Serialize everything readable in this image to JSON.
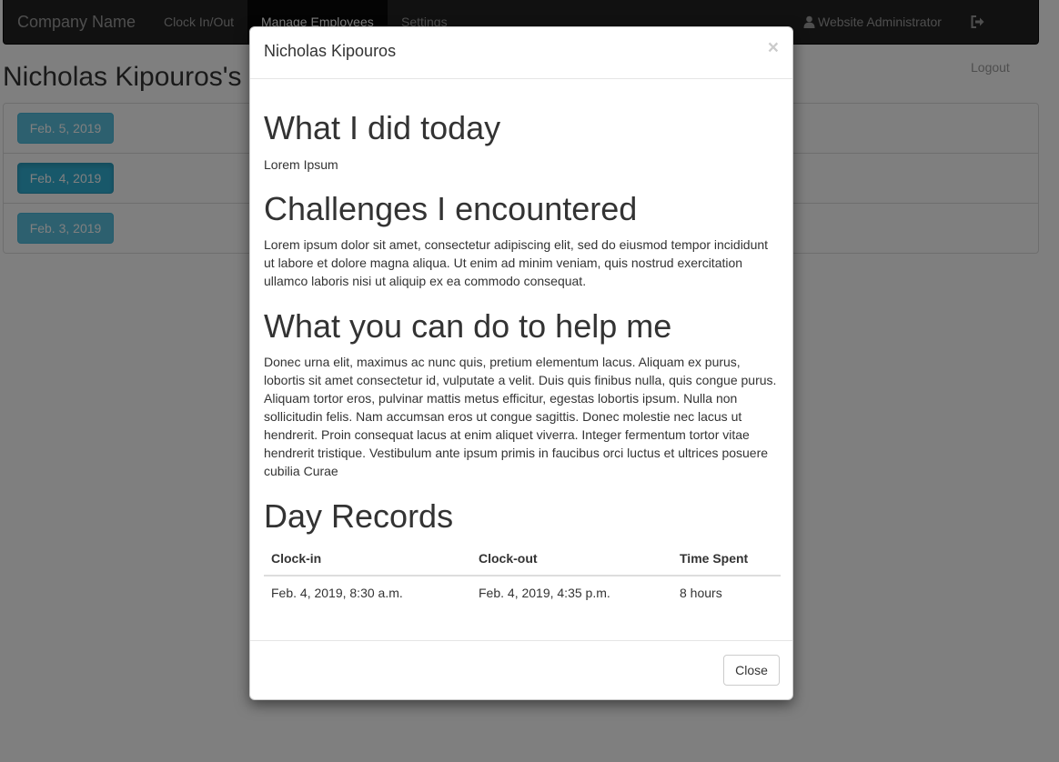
{
  "navbar": {
    "brand": "Company Name",
    "links": [
      {
        "label": "Clock In/Out"
      },
      {
        "label": "Manage Employees",
        "active": true
      },
      {
        "label": "Settings"
      }
    ],
    "user": {
      "label": "Website Administrator",
      "icon": "user-icon"
    },
    "logout": {
      "label": "Logout",
      "icon": "logout-icon"
    }
  },
  "page": {
    "title": "Nicholas Kipouros's",
    "dates": [
      {
        "label": "Feb. 5, 2019"
      },
      {
        "label": "Feb. 4, 2019",
        "active": true
      },
      {
        "label": "Feb. 3, 2019"
      }
    ]
  },
  "modal": {
    "title": "Nicholas Kipouros",
    "close_symbol": "×",
    "sections": {
      "did": {
        "heading": "What I did today",
        "text": "Lorem Ipsum"
      },
      "challenges": {
        "heading": "Challenges I encountered",
        "text": "Lorem ipsum dolor sit amet, consectetur adipiscing elit, sed do eiusmod tempor incididunt ut labore et dolore magna aliqua. Ut enim ad minim veniam, quis nostrud exercitation ullamco laboris nisi ut aliquip ex ea commodo consequat."
      },
      "help": {
        "heading": "What you can do to help me",
        "text": "Donec urna elit, maximus ac nunc quis, pretium elementum lacus. Aliquam ex purus, lobortis sit amet consectetur id, vulputate a velit. Duis quis finibus nulla, quis congue purus. Aliquam tortor eros, pulvinar mattis metus efficitur, egestas lobortis ipsum. Nulla non sollicitudin felis. Nam accumsan eros ut congue sagittis. Donec molestie nec lacus ut hendrerit. Proin consequat lacus at enim aliquet viverra. Integer fermentum tortor vitae hendrerit tristique. Vestibulum ante ipsum primis in faucibus orci luctus et ultrices posuere cubilia Curae"
      }
    },
    "records": {
      "heading": "Day Records",
      "columns": [
        "Clock-in",
        "Clock-out",
        "Time Spent"
      ],
      "rows": [
        [
          "Feb. 4, 2019, 8:30 a.m.",
          "Feb. 4, 2019, 4:35 p.m.",
          "8 hours"
        ]
      ]
    },
    "footer": {
      "close_label": "Close"
    }
  }
}
